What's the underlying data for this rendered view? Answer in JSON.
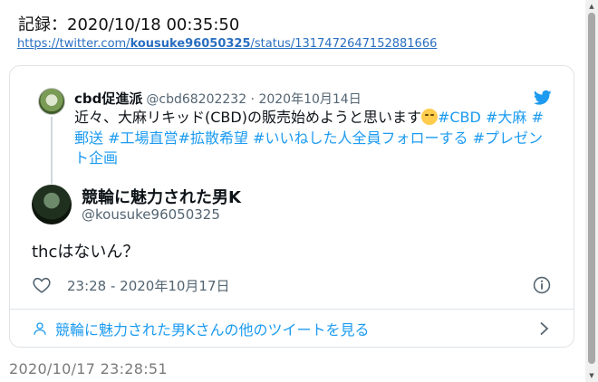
{
  "record": {
    "label": "記録：2020/10/18 00:35:50"
  },
  "source_url": {
    "prefix": "https://twitter.com/",
    "user": "kousuke96050325",
    "suffix": "/status/1317472647152881666"
  },
  "quoted_tweet": {
    "name": "cbd促進派",
    "meta": "@cbd68202232 · 2020年10月14日",
    "text_plain": "近々、大麻リキッド(CBD)の販売始めようと思います",
    "tags": [
      "#CBD",
      "#大麻",
      "#郵送",
      "#工場直営",
      "#拡散希望",
      "#いいねした人全員フォローする",
      "#プレゼント企画"
    ]
  },
  "main_tweet": {
    "name": "競輪に魅力された男K",
    "handle": "@kousuke96050325",
    "text": "thcはないん？",
    "timestamp": "23:28 - 2020年10月17日"
  },
  "more_link": {
    "label": "競輪に魅力された男Kさんの他のツイートを見る"
  },
  "footer": {
    "timestamp": "2020/10/17 23:28:51"
  },
  "colors": {
    "accent": "#1d9bf0",
    "link": "#2a6fc1",
    "muted": "#536471"
  }
}
